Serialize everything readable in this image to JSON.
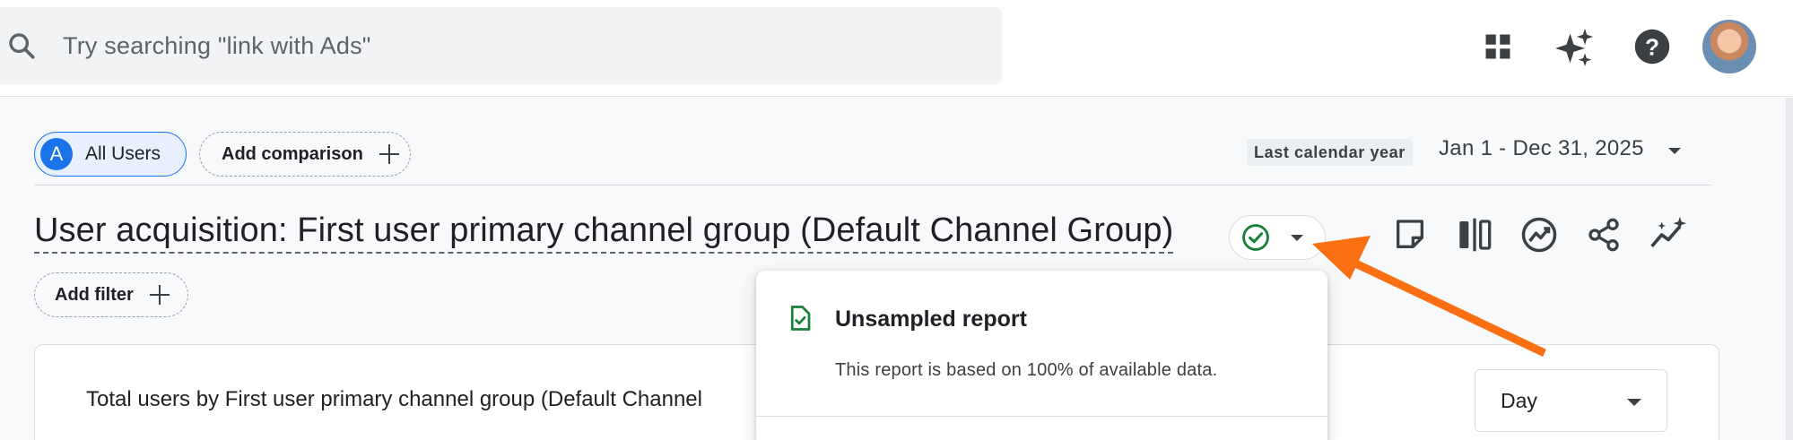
{
  "search": {
    "placeholder": "Try searching \"link with Ads\""
  },
  "header_icons": [
    "apps-grid-icon",
    "sparkle-icon",
    "help-icon",
    "avatar"
  ],
  "comparison": {
    "segment_letter": "A",
    "segment_label": "All Users",
    "add_comparison_label": "Add comparison"
  },
  "date": {
    "preset_label": "Last calendar year",
    "range": "Jan 1 - Dec 31, 2025"
  },
  "report": {
    "title": "User acquisition: First user primary channel group (Default Channel Group)",
    "add_filter_label": "Add filter",
    "status_color": "#188038"
  },
  "toolbar_icons": [
    "notes-icon",
    "compare-columns-icon",
    "insights-icon",
    "share-icon",
    "trend-sparkle-icon"
  ],
  "popup": {
    "title": "Unsampled report",
    "description": "This report is based on 100% of available data."
  },
  "card": {
    "title": "Total users by First user primary channel group (Default Channel",
    "granularity": "Day"
  },
  "colors": {
    "accent": "#1a73e8",
    "annotation_arrow": "#f96f12"
  }
}
